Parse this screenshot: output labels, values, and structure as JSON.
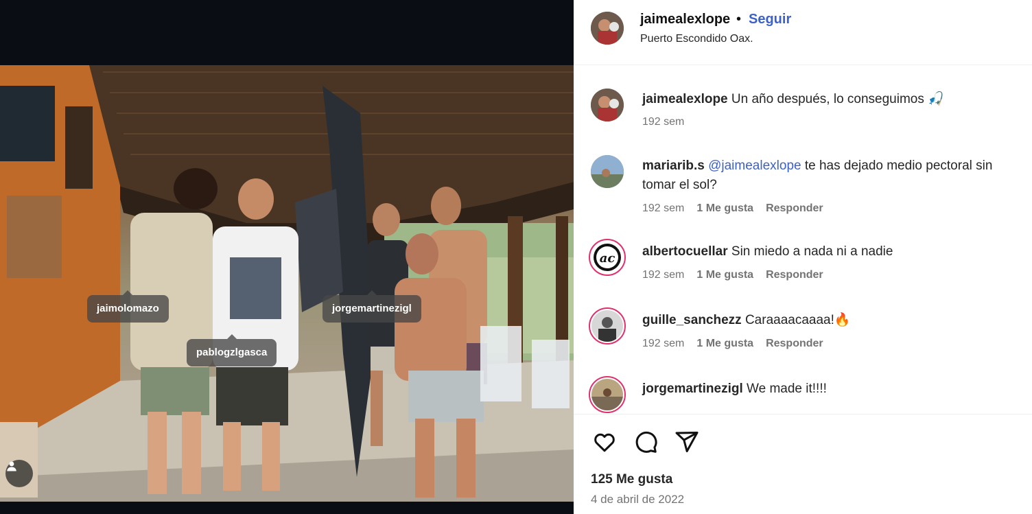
{
  "post": {
    "author": "jaimealexlope",
    "separator": "•",
    "follow_label": "Seguir",
    "location": "Puerto Escondido Oax.",
    "likes": "125 Me gusta",
    "date": "4 de abril de 2022"
  },
  "photo_tags": [
    {
      "username": "jaimolomazo"
    },
    {
      "username": "pablogzlgasca"
    },
    {
      "username": "jorgemartinezigl"
    }
  ],
  "comments": [
    {
      "username": "jaimealexlope",
      "mention": "",
      "text": "Un año después, lo conseguimos",
      "emoji": "🎣",
      "time": "192 sem",
      "likes": "",
      "reply": ""
    },
    {
      "username": "mariarib.s",
      "mention": "@jaimealexlope",
      "text": "te has dejado medio pectoral sin tomar el sol?",
      "emoji": "",
      "time": "192 sem",
      "likes": "1 Me gusta",
      "reply": "Responder"
    },
    {
      "username": "albertocuellar",
      "mention": "",
      "text": "Sin miedo a nada ni a nadie",
      "emoji": "",
      "time": "192 sem",
      "likes": "1 Me gusta",
      "reply": "Responder"
    },
    {
      "username": "guille_sanchezz",
      "mention": "",
      "text": "Caraaaacaaaa!",
      "emoji": "🔥",
      "time": "192 sem",
      "likes": "1 Me gusta",
      "reply": "Responder"
    },
    {
      "username": "jorgemartinezigl",
      "mention": "",
      "text": "We made it!!!!",
      "emoji": "",
      "time": "",
      "likes": "",
      "reply": ""
    }
  ],
  "icons": {
    "like": "heart-icon",
    "comment": "comment-icon",
    "share": "share-icon",
    "tagged_users": "user-icon"
  },
  "colors": {
    "link": "#3c61c7",
    "meta": "#737373",
    "story_ring": "#e1306c"
  }
}
